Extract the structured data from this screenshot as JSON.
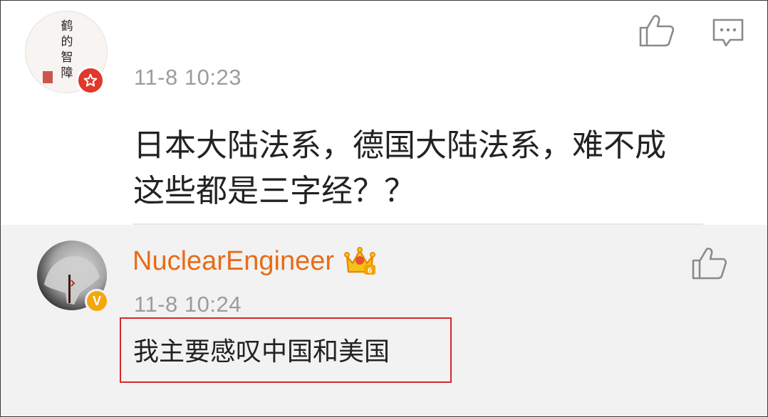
{
  "comment": {
    "avatar_text": "鹤的智障",
    "timestamp": "11-8 10:23",
    "text_line1": "日本大陆法系，德国大陆法系，难不成",
    "text_line2": "这些都是三字经？？",
    "badge_color": "#e0392b"
  },
  "reply": {
    "username": "NuclearEngineer",
    "verified_badge": "V",
    "member_level": "6",
    "timestamp": "11-8 10:24",
    "text": "我主要感叹中国和美国",
    "username_color": "#e86c16",
    "highlight_color": "#d9262b"
  },
  "icons": {
    "like": "thumbs-up-icon",
    "comment": "comment-bubble-icon",
    "crown": "crown-vip-icon",
    "star": "star-badge-icon"
  }
}
